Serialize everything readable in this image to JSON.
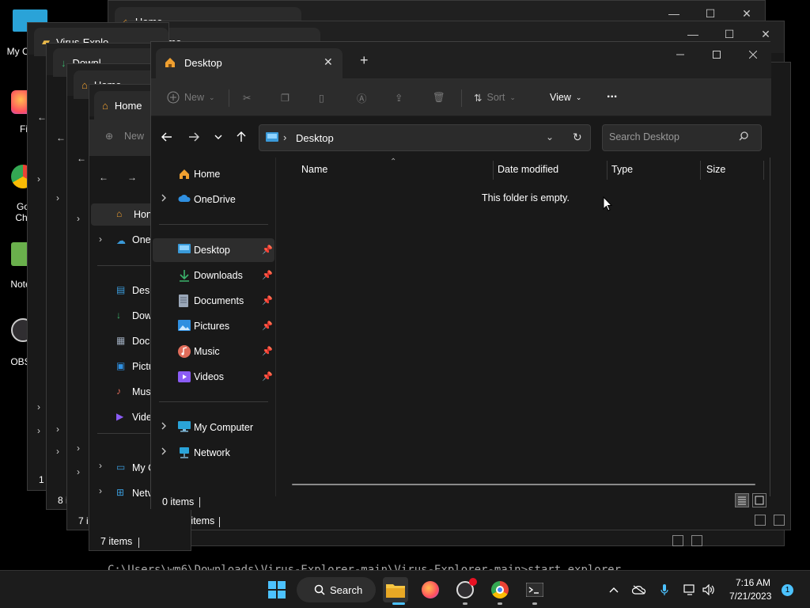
{
  "desktop": {
    "icons": [
      {
        "label": "My Co",
        "icon": "computer-icon"
      },
      {
        "label": "Fir",
        "icon": "firefox-icon"
      },
      {
        "label": "Go Chr",
        "icon": "chrome-icon"
      },
      {
        "label": "Note",
        "icon": "notepad-icon"
      },
      {
        "label": "OBS",
        "icon": "obs-icon"
      }
    ],
    "console_text": "C:\\Users\\wm6\\Downloads\\Virus-Explorer-main\\Virus-Explorer-main>start explorer"
  },
  "background_windows": [
    {
      "tab": "Home",
      "status": ""
    },
    {
      "tab": "Home",
      "status": ""
    },
    {
      "tab": "Virus-Explo",
      "status": "1 i"
    },
    {
      "tab": "Downl",
      "status": "8 i"
    },
    {
      "tab": "Home",
      "status": "7 i"
    },
    {
      "tab": "Home",
      "status": "7 items"
    },
    {
      "tab": "Home",
      "status": "7 items"
    }
  ],
  "background_sidebar_labels": [
    "Hon",
    "One",
    "Desk",
    "Dow",
    "Docu",
    "Pictu",
    "Mus",
    "Vide",
    "My C",
    "Netv"
  ],
  "background_new_label": "New",
  "main": {
    "tab_title": "Desktop",
    "toolbar": {
      "new_label": "New",
      "sort_label": "Sort",
      "view_label": "View",
      "more_label": "..."
    },
    "address": {
      "path": "Desktop"
    },
    "search": {
      "placeholder": "Search Desktop"
    },
    "sidebar": {
      "home": "Home",
      "onedrive": "OneDrive",
      "pinned": [
        {
          "label": "Desktop",
          "icon": "desktop-folder-icon",
          "color": "#3a9ad9"
        },
        {
          "label": "Downloads",
          "icon": "download-icon",
          "color": "#3bb26b"
        },
        {
          "label": "Documents",
          "icon": "document-icon",
          "color": "#9aa7b8"
        },
        {
          "label": "Pictures",
          "icon": "pictures-icon",
          "color": "#2f8fe0"
        },
        {
          "label": "Music",
          "icon": "music-icon",
          "color": "#e06c5a"
        },
        {
          "label": "Videos",
          "icon": "videos-icon",
          "color": "#8b5cf6"
        }
      ],
      "my_computer": "My Computer",
      "network": "Network"
    },
    "columns": [
      "Name",
      "Date modified",
      "Type",
      "Size"
    ],
    "empty_message": "This folder is empty.",
    "status_text": "0 items"
  },
  "taskbar": {
    "search_label": "Search",
    "time": "7:16 AM",
    "date": "7/21/2023",
    "notification_count": "1"
  },
  "colors": {
    "accent": "#4cc2ff",
    "window_bg": "#191919",
    "toolbar_bg": "#2c2c2c"
  }
}
